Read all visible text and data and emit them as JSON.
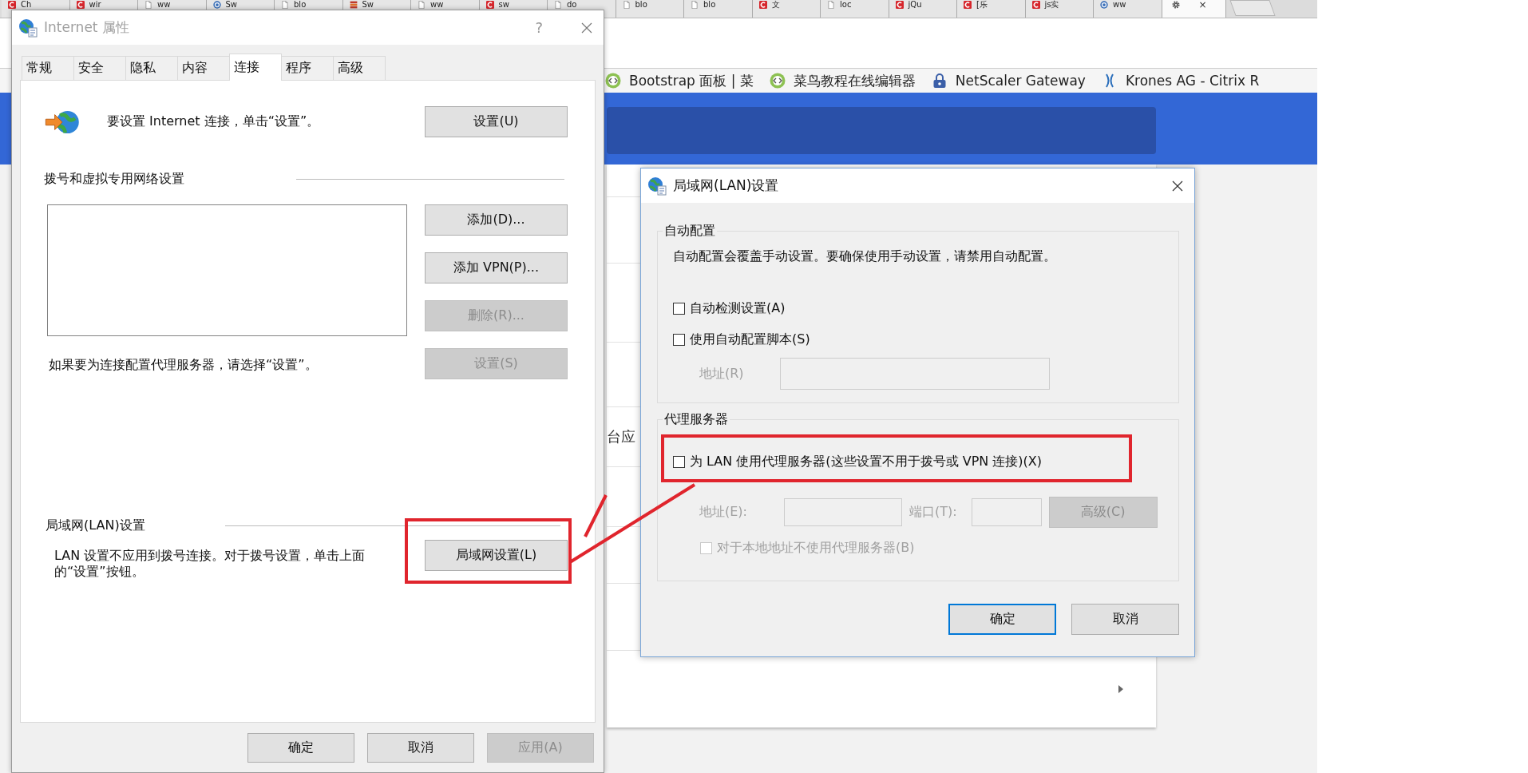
{
  "browser": {
    "tabs": [
      {
        "title": "Ch",
        "kind": "logo",
        "selected": false
      },
      {
        "title": "wir",
        "kind": "logo",
        "selected": false
      },
      {
        "title": "ww",
        "kind": "page",
        "selected": false
      },
      {
        "title": "Sw",
        "kind": "swirl",
        "selected": false
      },
      {
        "title": "blo",
        "kind": "page",
        "selected": false
      },
      {
        "title": "Sw",
        "kind": "stack",
        "selected": false
      },
      {
        "title": "ww",
        "kind": "page",
        "selected": false
      },
      {
        "title": "sw",
        "kind": "logo",
        "selected": false
      },
      {
        "title": "do",
        "kind": "page",
        "selected": false
      },
      {
        "title": "blo",
        "kind": "page",
        "selected": false
      },
      {
        "title": "blo",
        "kind": "page",
        "selected": false
      },
      {
        "title": "文",
        "kind": "logo",
        "selected": false
      },
      {
        "title": "loc",
        "kind": "page",
        "selected": false
      },
      {
        "title": "jQu",
        "kind": "logo",
        "selected": false
      },
      {
        "title": "[乐",
        "kind": "logo",
        "selected": false
      },
      {
        "title": "js实",
        "kind": "logo",
        "selected": false
      },
      {
        "title": "ww",
        "kind": "swirl",
        "selected": false
      }
    ],
    "settings_tab": {
      "close": "×",
      "selected": true
    },
    "bookmarks": [
      {
        "title": "Bootstrap 面板 | 菜",
        "kind": "code"
      },
      {
        "title": "菜鸟教程在线编辑器",
        "kind": "code"
      },
      {
        "title": "NetScaler Gateway",
        "kind": "lock"
      },
      {
        "title": "Krones AG - Citrix R",
        "kind": "citrix"
      }
    ],
    "page_text": "台应"
  },
  "internet_options": {
    "title": "Internet 属性",
    "help": "?",
    "tabs": [
      {
        "label": "常规",
        "selected": false
      },
      {
        "label": "安全",
        "selected": false
      },
      {
        "label": "隐私",
        "selected": false
      },
      {
        "label": "内容",
        "selected": false
      },
      {
        "label": "连接",
        "selected": true
      },
      {
        "label": "程序",
        "selected": false
      },
      {
        "label": "高级",
        "selected": false
      }
    ],
    "setup_text": "要设置 Internet 连接，单击“设置”。",
    "setup_button": {
      "label": "设置(U)",
      "disabled": false
    },
    "dialup_heading": "拨号和虚拟专用网络设置",
    "dialup_buttons": [
      {
        "label": "添加(D)...",
        "disabled": false
      },
      {
        "label": "添加 VPN(P)...",
        "disabled": false
      },
      {
        "label": "删除(R)...",
        "disabled": true
      },
      {
        "label": "设置(S)",
        "disabled": true
      }
    ],
    "proxy_hint": "如果要为连接配置代理服务器，请选择“设置”。",
    "lan_heading": "局域网(LAN)设置",
    "lan_text": "LAN 设置不应用到拨号连接。对于拨号设置，单击上面的“设置”按钮。",
    "lan_button": {
      "label": "局域网设置(L)",
      "disabled": false
    },
    "buttons": [
      {
        "label": "确定",
        "disabled": false
      },
      {
        "label": "取消",
        "disabled": false
      },
      {
        "label": "应用(A)",
        "disabled": true
      }
    ]
  },
  "lan_dialog": {
    "title": "局域网(LAN)设置",
    "auto_config": {
      "title": "自动配置",
      "description": "自动配置会覆盖手动设置。要确保使用手动设置，请禁用自动配置。",
      "options": [
        {
          "label": "自动检测设置(A)",
          "checked": false
        },
        {
          "label": "使用自动配置脚本(S)",
          "checked": false
        }
      ],
      "address_label": "地址(R)",
      "address_disabled": true
    },
    "proxy": {
      "title": "代理服务器",
      "use_proxy": {
        "label": "为 LAN 使用代理服务器(这些设置不用于拨号或 VPN 连接)(X)",
        "checked": false
      },
      "address_label": "地址(E):",
      "port_label": "端口(T):",
      "fields_disabled": true,
      "advanced_button": {
        "label": "高级(C)",
        "disabled": true
      },
      "bypass": {
        "label": "对于本地地址不使用代理服务器(B)",
        "checked": false,
        "disabled": true
      }
    },
    "buttons": [
      {
        "label": "确定",
        "default": true
      },
      {
        "label": "取消",
        "default": false
      }
    ]
  }
}
